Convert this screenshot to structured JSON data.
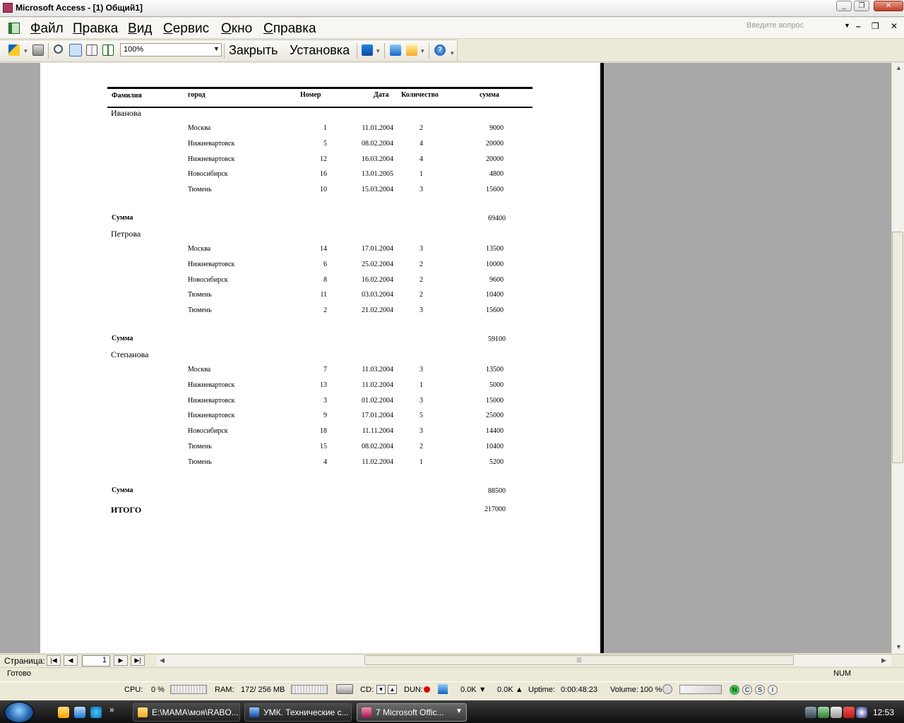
{
  "window": {
    "title": "Microsoft Access - [1) Общий1]"
  },
  "menu": [
    {
      "label": "Файл",
      "accel": "Ф",
      "rest": "айл"
    },
    {
      "label": "Правка",
      "accel": "П",
      "rest": "равка"
    },
    {
      "label": "Вид",
      "accel": "В",
      "rest": "ид"
    },
    {
      "label": "Сервис",
      "accel": "С",
      "rest": "ервис"
    },
    {
      "label": "Окно",
      "accel": "О",
      "rest": "кно"
    },
    {
      "label": "Справка",
      "accel": "С",
      "rest": "правка"
    }
  ],
  "help_box": {
    "placeholder": "Введите вопрос"
  },
  "toolbar": {
    "zoom": "100%",
    "close_label": "Закрыть",
    "setup_label": "Установка",
    "icons": [
      "view-icon",
      "print-icon",
      "zoom-icon",
      "one-page-icon",
      "two-pages-icon",
      "multiple-pages-icon",
      "office-links-icon",
      "database-window-icon",
      "new-object-icon",
      "help-icon"
    ]
  },
  "report": {
    "headers": {
      "surname": "Фамилия",
      "city": "город",
      "number": "Номер",
      "date": "Дата",
      "qty": "Количество",
      "sum": "сумма"
    },
    "groups": [
      {
        "name": "Иванова",
        "rows": [
          {
            "city": "Москва",
            "number": "1",
            "date": "11.01.2004",
            "qty": "2",
            "sum": "9000"
          },
          {
            "city": "Нижневартовск",
            "number": "5",
            "date": "08.02.2004",
            "qty": "4",
            "sum": "20000"
          },
          {
            "city": "Нижневартовск",
            "number": "12",
            "date": "16.03.2004",
            "qty": "4",
            "sum": "20000"
          },
          {
            "city": "Новосибирск",
            "number": "16",
            "date": "13.01.2005",
            "qty": "1",
            "sum": "4800"
          },
          {
            "city": "Тюмень",
            "number": "10",
            "date": "15.03.2004",
            "qty": "3",
            "sum": "15600"
          }
        ],
        "total_label": "Сумма",
        "total": "69400"
      },
      {
        "name": "Петрова",
        "rows": [
          {
            "city": "Москва",
            "number": "14",
            "date": "17.01.2004",
            "qty": "3",
            "sum": "13500"
          },
          {
            "city": "Нижневартовск",
            "number": "6",
            "date": "25.02.2004",
            "qty": "2",
            "sum": "10000"
          },
          {
            "city": "Новосибирск",
            "number": "8",
            "date": "16.02.2004",
            "qty": "2",
            "sum": "9600"
          },
          {
            "city": "Тюмень",
            "number": "11",
            "date": "03.03.2004",
            "qty": "2",
            "sum": "10400"
          },
          {
            "city": "Тюмень",
            "number": "2",
            "date": "21.02.2004",
            "qty": "3",
            "sum": "15600"
          }
        ],
        "total_label": "Сумма",
        "total": "59100"
      },
      {
        "name": "Степанова",
        "rows": [
          {
            "city": "Москва",
            "number": "7",
            "date": "11.03.2004",
            "qty": "3",
            "sum": "13500"
          },
          {
            "city": "Нижневартовск",
            "number": "13",
            "date": "11.02.2004",
            "qty": "1",
            "sum": "5000"
          },
          {
            "city": "Нижневартовск",
            "number": "3",
            "date": "01.02.2004",
            "qty": "3",
            "sum": "15000"
          },
          {
            "city": "Нижневартовск",
            "number": "9",
            "date": "17.01.2004",
            "qty": "5",
            "sum": "25000"
          },
          {
            "city": "Новосибирск",
            "number": "18",
            "date": "11.11.2004",
            "qty": "3",
            "sum": "14400"
          },
          {
            "city": "Тюмень",
            "number": "15",
            "date": "08.02.2004",
            "qty": "2",
            "sum": "10400"
          },
          {
            "city": "Тюмень",
            "number": "4",
            "date": "11.02.2004",
            "qty": "1",
            "sum": "5200"
          }
        ],
        "total_label": "Сумма",
        "total": "88500"
      }
    ],
    "grand_total_label": "ИТОГО",
    "grand_total": "217000"
  },
  "navigation": {
    "label": "Страница:",
    "page": "1"
  },
  "status": {
    "text": "Готово",
    "num": "NUM"
  },
  "sysmon": {
    "cpu_label": "CPU:",
    "cpu_value": "0 %",
    "ram_label": "RAM:",
    "ram_value": "172/ 256 MB",
    "cd_label": "CD:",
    "dun_label": "DUN:",
    "down_rate": "0.0K",
    "up_rate": "0.0K",
    "uptime_label": "Uptime:",
    "uptime_value": "0:00:48:23",
    "volume_label": "Volume:",
    "volume_value": "100 %",
    "leds": [
      "N",
      "C",
      "S",
      "I"
    ]
  },
  "taskbar": {
    "tasks": [
      {
        "label": "E:\\МАМА\\моя\\RABO...",
        "active": false
      },
      {
        "label": "УМК. Технические с...",
        "active": false
      },
      {
        "label": "7 Microsoft Offic...",
        "active": true
      }
    ],
    "clock": "12:53"
  }
}
